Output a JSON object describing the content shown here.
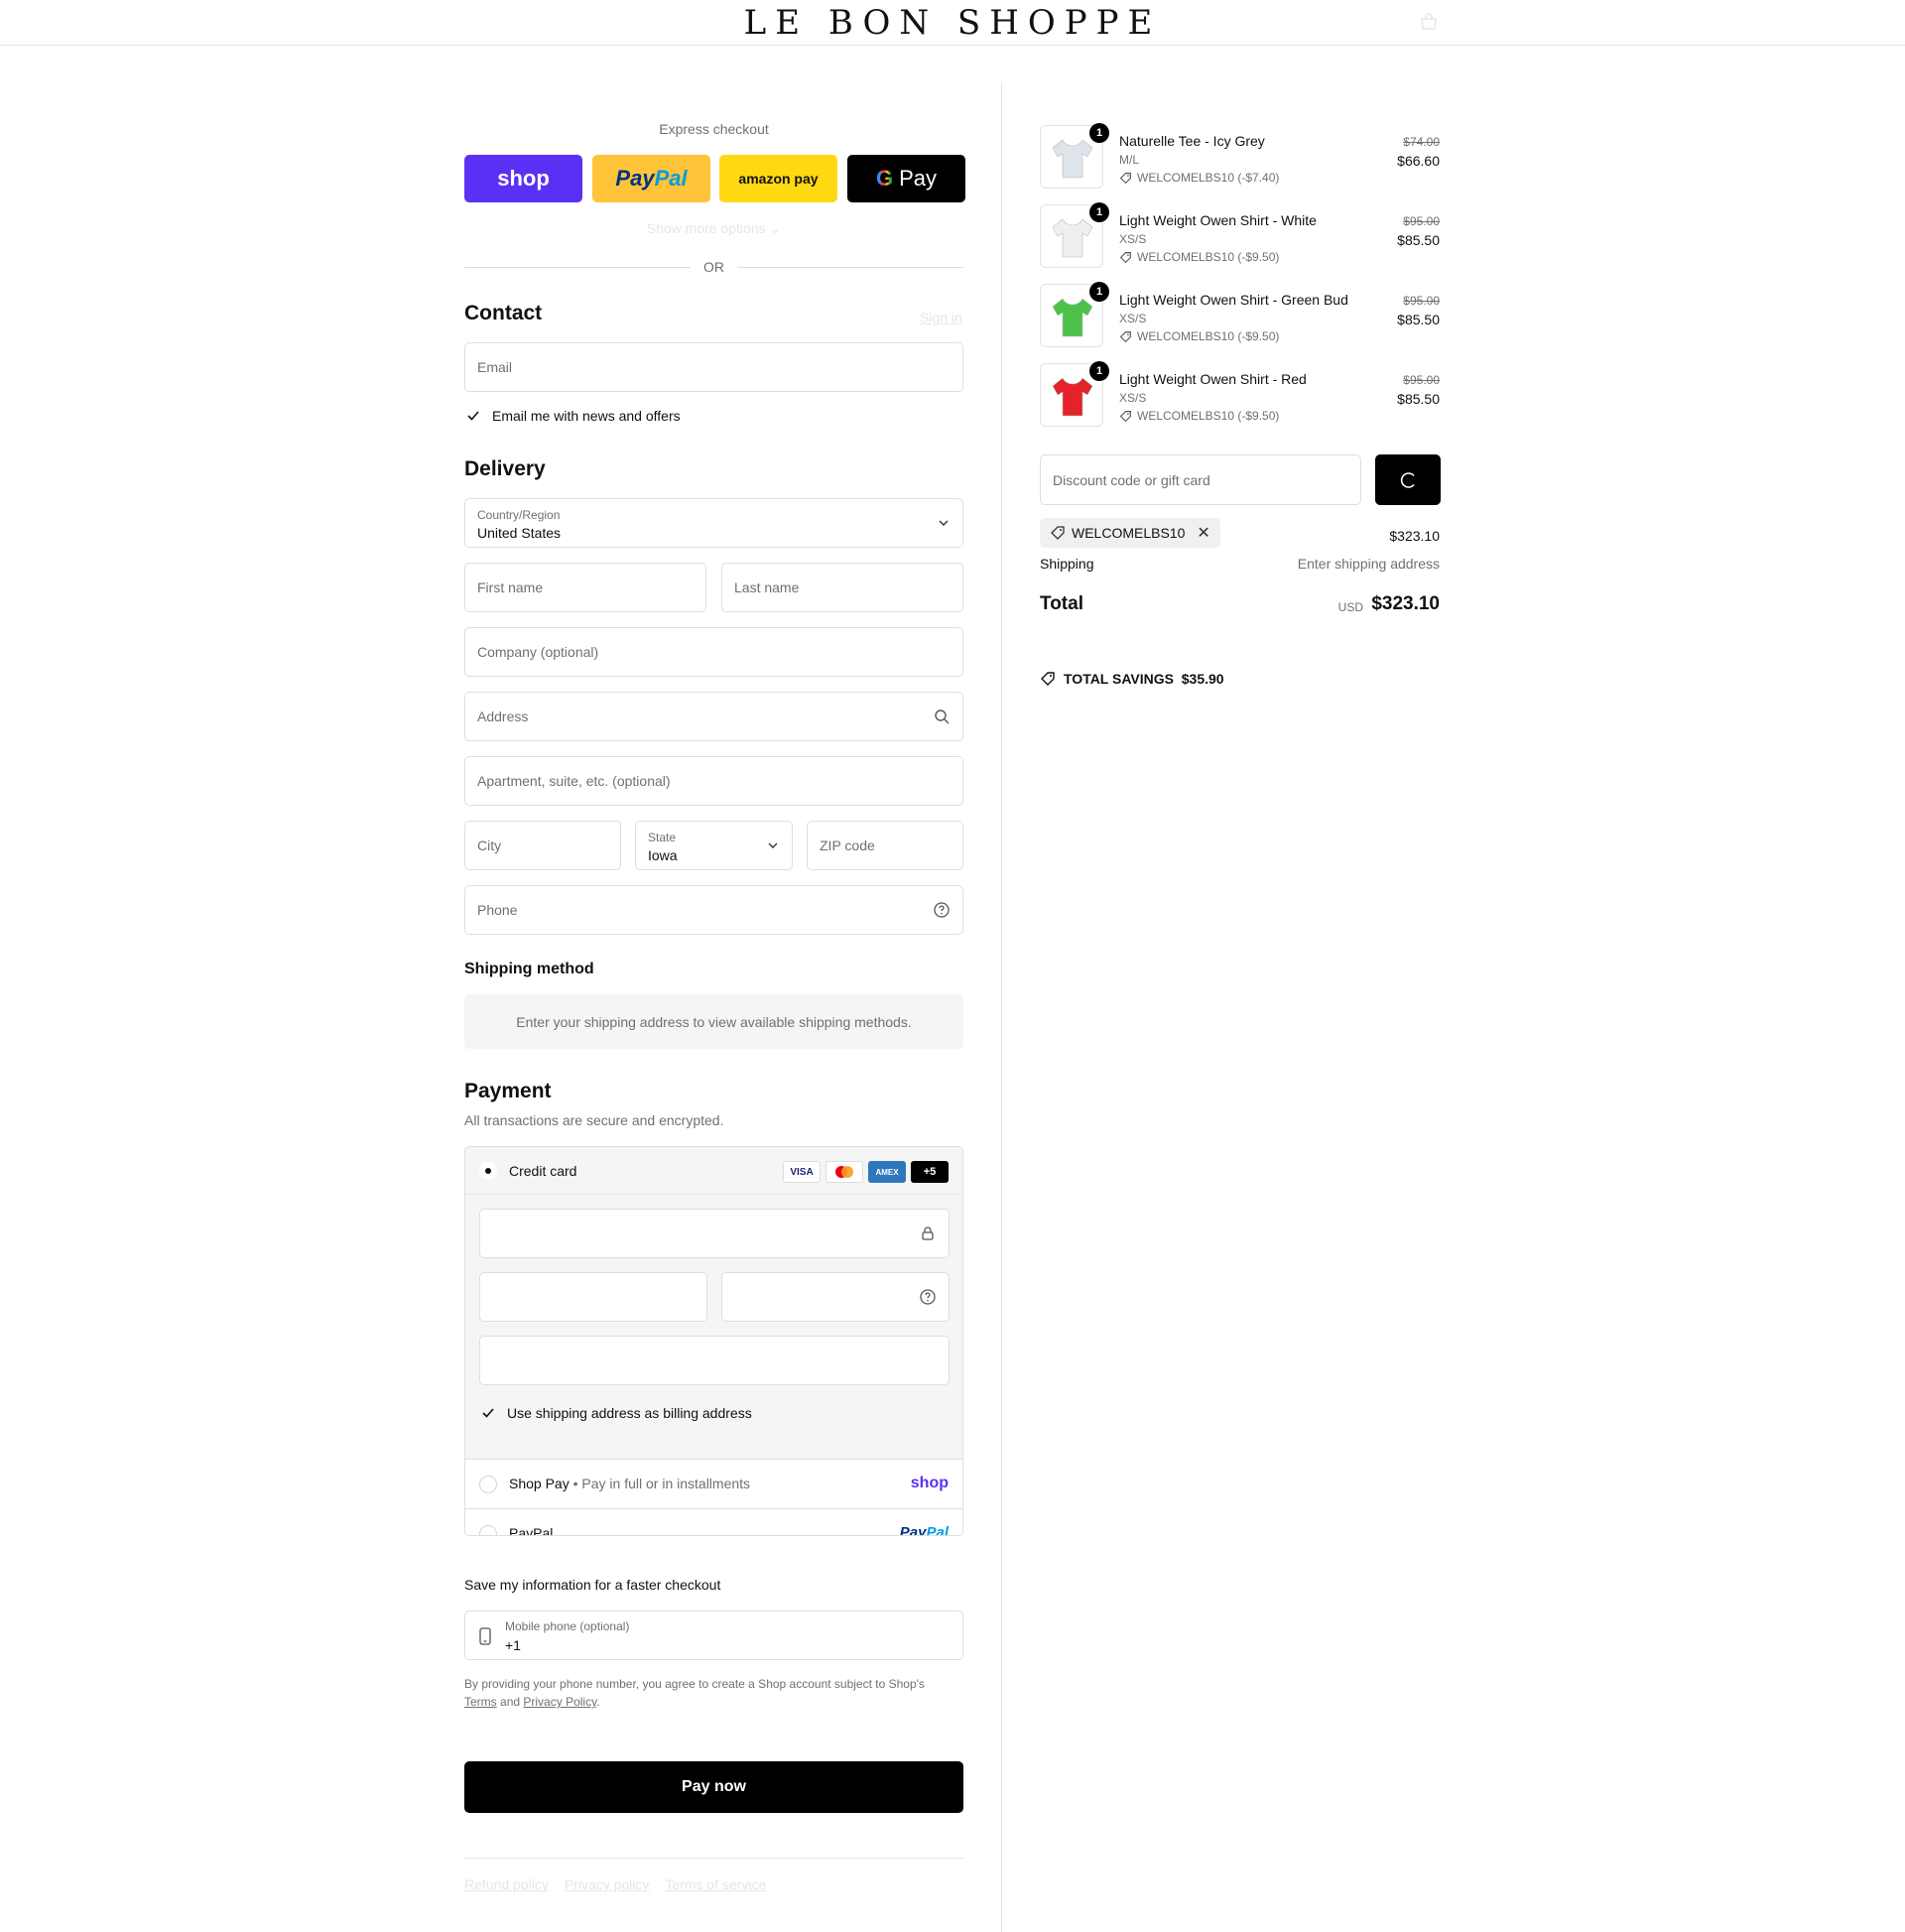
{
  "header": {
    "logo": "LE BON SHOPPE",
    "cart_icon": "bag-icon"
  },
  "express": {
    "label": "Express checkout",
    "buttons": {
      "shop": "shop",
      "paypal_a": "Pay",
      "paypal_b": "Pal",
      "amazon": "amazon pay",
      "gpay_g": "G",
      "gpay": "Pay"
    },
    "more": "Show more options",
    "or": "OR"
  },
  "contact": {
    "title": "Contact",
    "signin": "Sign in",
    "email_placeholder": "Email",
    "news_label": "Email me with news and offers",
    "news_checked": true
  },
  "delivery": {
    "title": "Delivery",
    "country_label": "Country/Region",
    "country_value": "United States",
    "first_name": "First name",
    "last_name": "Last name",
    "company": "Company (optional)",
    "address": "Address",
    "apartment": "Apartment, suite, etc. (optional)",
    "city": "City",
    "state_label": "State",
    "state_value": "Iowa",
    "zip": "ZIP code",
    "phone": "Phone"
  },
  "shipping": {
    "title": "Shipping method",
    "message": "Enter your shipping address to view available shipping methods."
  },
  "payment": {
    "title": "Payment",
    "subtitle": "All transactions are secure and encrypted.",
    "credit_card": "Credit card",
    "cards": {
      "visa": "VISA",
      "amex": "AMEX",
      "more": "+5"
    },
    "billing_label": "Use shipping address as billing address",
    "shop_pay": "Shop Pay",
    "shop_pay_note": "Pay in full or in installments",
    "shop_wordmark": "shop",
    "paypal": "PayPal",
    "paypal_wordmark_a": "Pay",
    "paypal_wordmark_b": "Pal"
  },
  "save_info": {
    "title": "Save my information for a faster checkout",
    "mobile_label": "Mobile phone (optional)",
    "mobile_value": "+1",
    "consent_text": "By providing your phone number, you agree to create a Shop account subject to Shop's",
    "terms": "Terms",
    "and": "and",
    "privacy": "Privacy Policy"
  },
  "pay_now": "Pay now",
  "footer": {
    "refund": "Refund policy",
    "privacy": "Privacy policy",
    "terms": "Terms of service"
  },
  "order": {
    "items": [
      {
        "name": "Naturelle Tee - Icy Grey",
        "variant": "M/L",
        "discount": "WELCOMELBS10 (-$7.40)",
        "old_price": "$74.00",
        "price": "$66.60",
        "qty": "1",
        "color": "#dfe3ea"
      },
      {
        "name": "Light Weight Owen Shirt - White",
        "variant": "XS/S",
        "discount": "WELCOMELBS10 (-$9.50)",
        "old_price": "$95.00",
        "price": "$85.50",
        "qty": "1",
        "color": "#eef0ee"
      },
      {
        "name": "Light Weight Owen Shirt - Green Bud",
        "variant": "XS/S",
        "discount": "WELCOMELBS10 (-$9.50)",
        "old_price": "$95.00",
        "price": "$85.50",
        "qty": "1",
        "color": "#4cc24a"
      },
      {
        "name": "Light Weight Owen Shirt - Red",
        "variant": "XS/S",
        "discount": "WELCOMELBS10 (-$9.50)",
        "old_price": "$95.00",
        "price": "$85.50",
        "qty": "1",
        "color": "#e3222a"
      }
    ],
    "discount_placeholder": "Discount code or gift card",
    "applied_code": "WELCOMELBS10",
    "subtotal": "$323.10",
    "shipping_label": "Shipping",
    "shipping_value": "Enter shipping address",
    "total_label": "Total",
    "currency": "USD",
    "total": "$323.10",
    "savings_label": "TOTAL SAVINGS",
    "savings_value": "$35.90"
  }
}
